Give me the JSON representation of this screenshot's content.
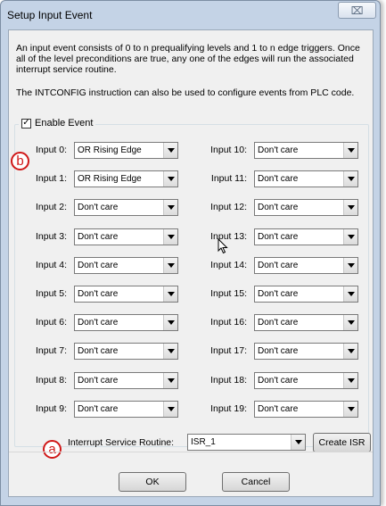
{
  "window": {
    "title": "Setup Input Event",
    "close_glyph": "⌧"
  },
  "description": {
    "line1": "An input event consists of 0 to n prequalifying levels and 1 to n edge triggers. Once all of the level preconditions are true, any one of the edges will run the associated interrupt service routine.",
    "line2": "The INTCONFIG instruction can also be used to configure events from PLC code."
  },
  "enable_event": {
    "label": "Enable Event",
    "checked_glyph": "✓"
  },
  "inputs_left": [
    {
      "label": "Input 0:",
      "value": "OR Rising Edge"
    },
    {
      "label": "Input 1:",
      "value": "OR Rising Edge"
    },
    {
      "label": "Input 2:",
      "value": "Don't care"
    },
    {
      "label": "Input 3:",
      "value": "Don't care"
    },
    {
      "label": "Input 4:",
      "value": "Don't care"
    },
    {
      "label": "Input 5:",
      "value": "Don't care"
    },
    {
      "label": "Input 6:",
      "value": "Don't care"
    },
    {
      "label": "Input 7:",
      "value": "Don't care"
    },
    {
      "label": "Input 8:",
      "value": "Don't care"
    },
    {
      "label": "Input 9:",
      "value": "Don't care"
    }
  ],
  "inputs_right": [
    {
      "label": "Input 10:",
      "value": "Don't care"
    },
    {
      "label": "Input 11:",
      "value": "Don't care"
    },
    {
      "label": "Input 12:",
      "value": "Don't care"
    },
    {
      "label": "Input 13:",
      "value": "Don't care"
    },
    {
      "label": "Input 14:",
      "value": "Don't care"
    },
    {
      "label": "Input 15:",
      "value": "Don't care"
    },
    {
      "label": "Input 16:",
      "value": "Don't care"
    },
    {
      "label": "Input 17:",
      "value": "Don't care"
    },
    {
      "label": "Input 18:",
      "value": "Don't care"
    },
    {
      "label": "Input 19:",
      "value": "Don't care"
    }
  ],
  "isr": {
    "label": "Interrupt Service Routine:",
    "value": "ISR_1",
    "create_button": "Create ISR"
  },
  "annotations": {
    "a": "a",
    "b": "b"
  },
  "buttons": {
    "ok": "OK",
    "cancel": "Cancel"
  },
  "colors": {
    "annotation": "#d01818",
    "title_bar": "#c4d3e6"
  }
}
